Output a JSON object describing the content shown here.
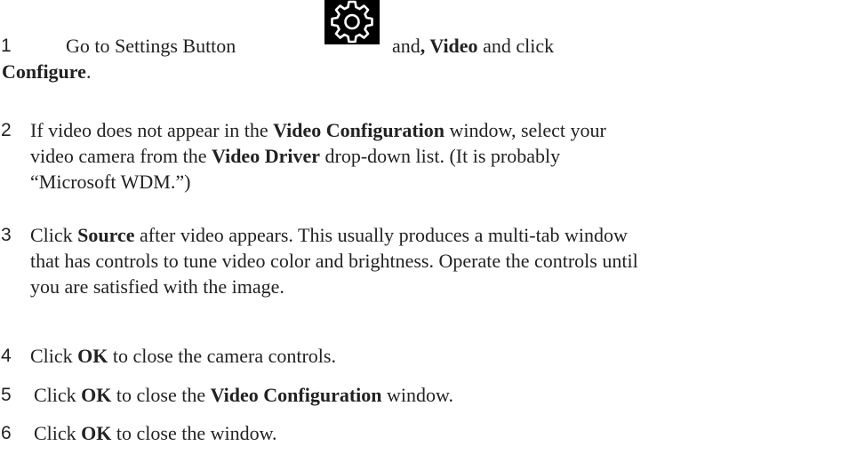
{
  "settings_button": {
    "icon": "gear-icon",
    "background": "#000000",
    "icon_color": "#ffffff"
  },
  "steps": [
    {
      "number": "1",
      "line1": {
        "a": "Go to Settings Button",
        "b": "and",
        "c": ", Video",
        "d": " and click"
      },
      "line2": {
        "bold": "Configure",
        "rest": "."
      }
    },
    {
      "number": "2",
      "line1": {
        "a": "If video does not appear in the ",
        "bold": "Video Configuration",
        "c": " window, select your"
      },
      "line2": {
        "a": "video camera from the ",
        "bold": "Video Driver",
        "c": " drop-down list. (It is probably"
      },
      "line3": {
        "a": "“Microsoft WDM.”)"
      }
    },
    {
      "number": "3",
      "line1": {
        "a": "Click ",
        "bold": "Source",
        "c": " after video appears. This usually produces a multi-tab window"
      },
      "line2": {
        "a": "that has controls to tune video color and brightness. Operate the controls until"
      },
      "line3": {
        "a": "you are satisfied with the image."
      }
    },
    {
      "number": "4",
      "line1": {
        "a": "Click ",
        "bold": "OK",
        "c": " to close the camera controls."
      }
    },
    {
      "number": "5",
      "line1": {
        "a": "Click ",
        "bold": "OK",
        "c": " to close the ",
        "bold2": "Video Configuration",
        "d": " window."
      }
    },
    {
      "number": "6",
      "line1": {
        "a": "Click ",
        "bold": "OK",
        "c": " to close the window."
      }
    }
  ]
}
